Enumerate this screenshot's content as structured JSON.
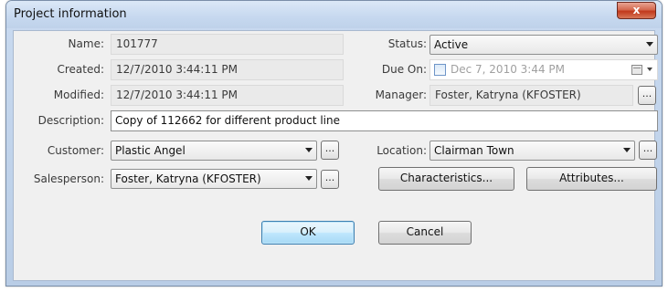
{
  "window": {
    "title": "Project information",
    "close_glyph": "x"
  },
  "fields": {
    "name": {
      "label": "Name:",
      "value": "101777"
    },
    "created": {
      "label": "Created:",
      "value": "12/7/2010 3:44:11 PM"
    },
    "modified": {
      "label": "Modified:",
      "value": "12/7/2010 3:44:11 PM"
    },
    "status": {
      "label": "Status:",
      "value": "Active"
    },
    "due_on": {
      "label": "Due On:",
      "value": "Dec  7, 2010  3:44 PM"
    },
    "manager": {
      "label": "Manager:",
      "value": "Foster, Katryna (KFOSTER)"
    },
    "description": {
      "label": "Description:",
      "value": "Copy of 112662 for different product line"
    },
    "customer": {
      "label": "Customer:",
      "value": "Plastic Angel"
    },
    "location": {
      "label": "Location:",
      "value": "Clairman Town"
    },
    "salesperson": {
      "label": "Salesperson:",
      "value": "Foster, Katryna (KFOSTER)"
    }
  },
  "buttons": {
    "ellipsis": "...",
    "characteristics": "Characteristics...",
    "attributes": "Attributes...",
    "ok": "OK",
    "cancel": "Cancel"
  }
}
